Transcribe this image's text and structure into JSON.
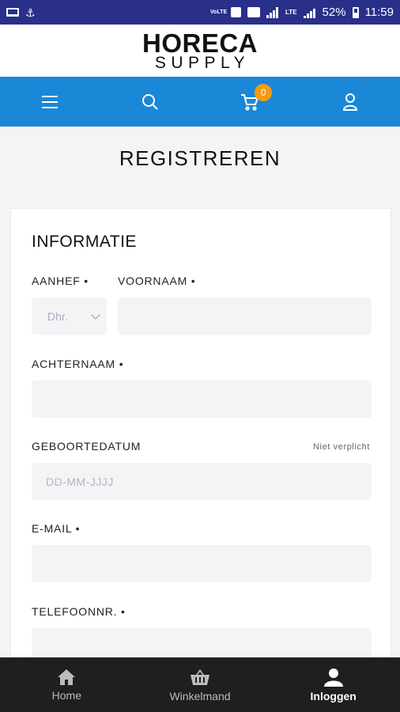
{
  "status_bar": {
    "battery": "52%",
    "time": "11:59",
    "volte_label": "VoLTE",
    "lte_label": "LTE"
  },
  "brand": {
    "line1": "HORECA",
    "line2": "SUPPLY"
  },
  "nav": {
    "cart_count": "0"
  },
  "page": {
    "title": "REGISTREREN"
  },
  "form": {
    "section_title": "INFORMATIE",
    "salutation_label": "AANHEF •",
    "salutation_value": "Dhr.",
    "firstname_label": "VOORNAAM •",
    "firstname_value": "",
    "lastname_label": "ACHTERNAAM •",
    "lastname_value": "",
    "birthdate_label": "GEBOORTEDATUM",
    "birthdate_optional": "Niet verplicht",
    "birthdate_placeholder": "DD-MM-JJJJ",
    "email_label": "E-MAIL •",
    "email_value": "",
    "phone_label": "TELEFOONNR. •",
    "phone_value": ""
  },
  "tabs": [
    {
      "label": "Home",
      "icon": "home-icon"
    },
    {
      "label": "Winkelmand",
      "icon": "basket-icon"
    },
    {
      "label": "Inloggen",
      "icon": "user-icon"
    }
  ],
  "colors": {
    "status_bar": "#2a2f8a",
    "nav_bar": "#1a88d6",
    "badge": "#f39b12",
    "tab_bar": "#1f1f1f"
  }
}
